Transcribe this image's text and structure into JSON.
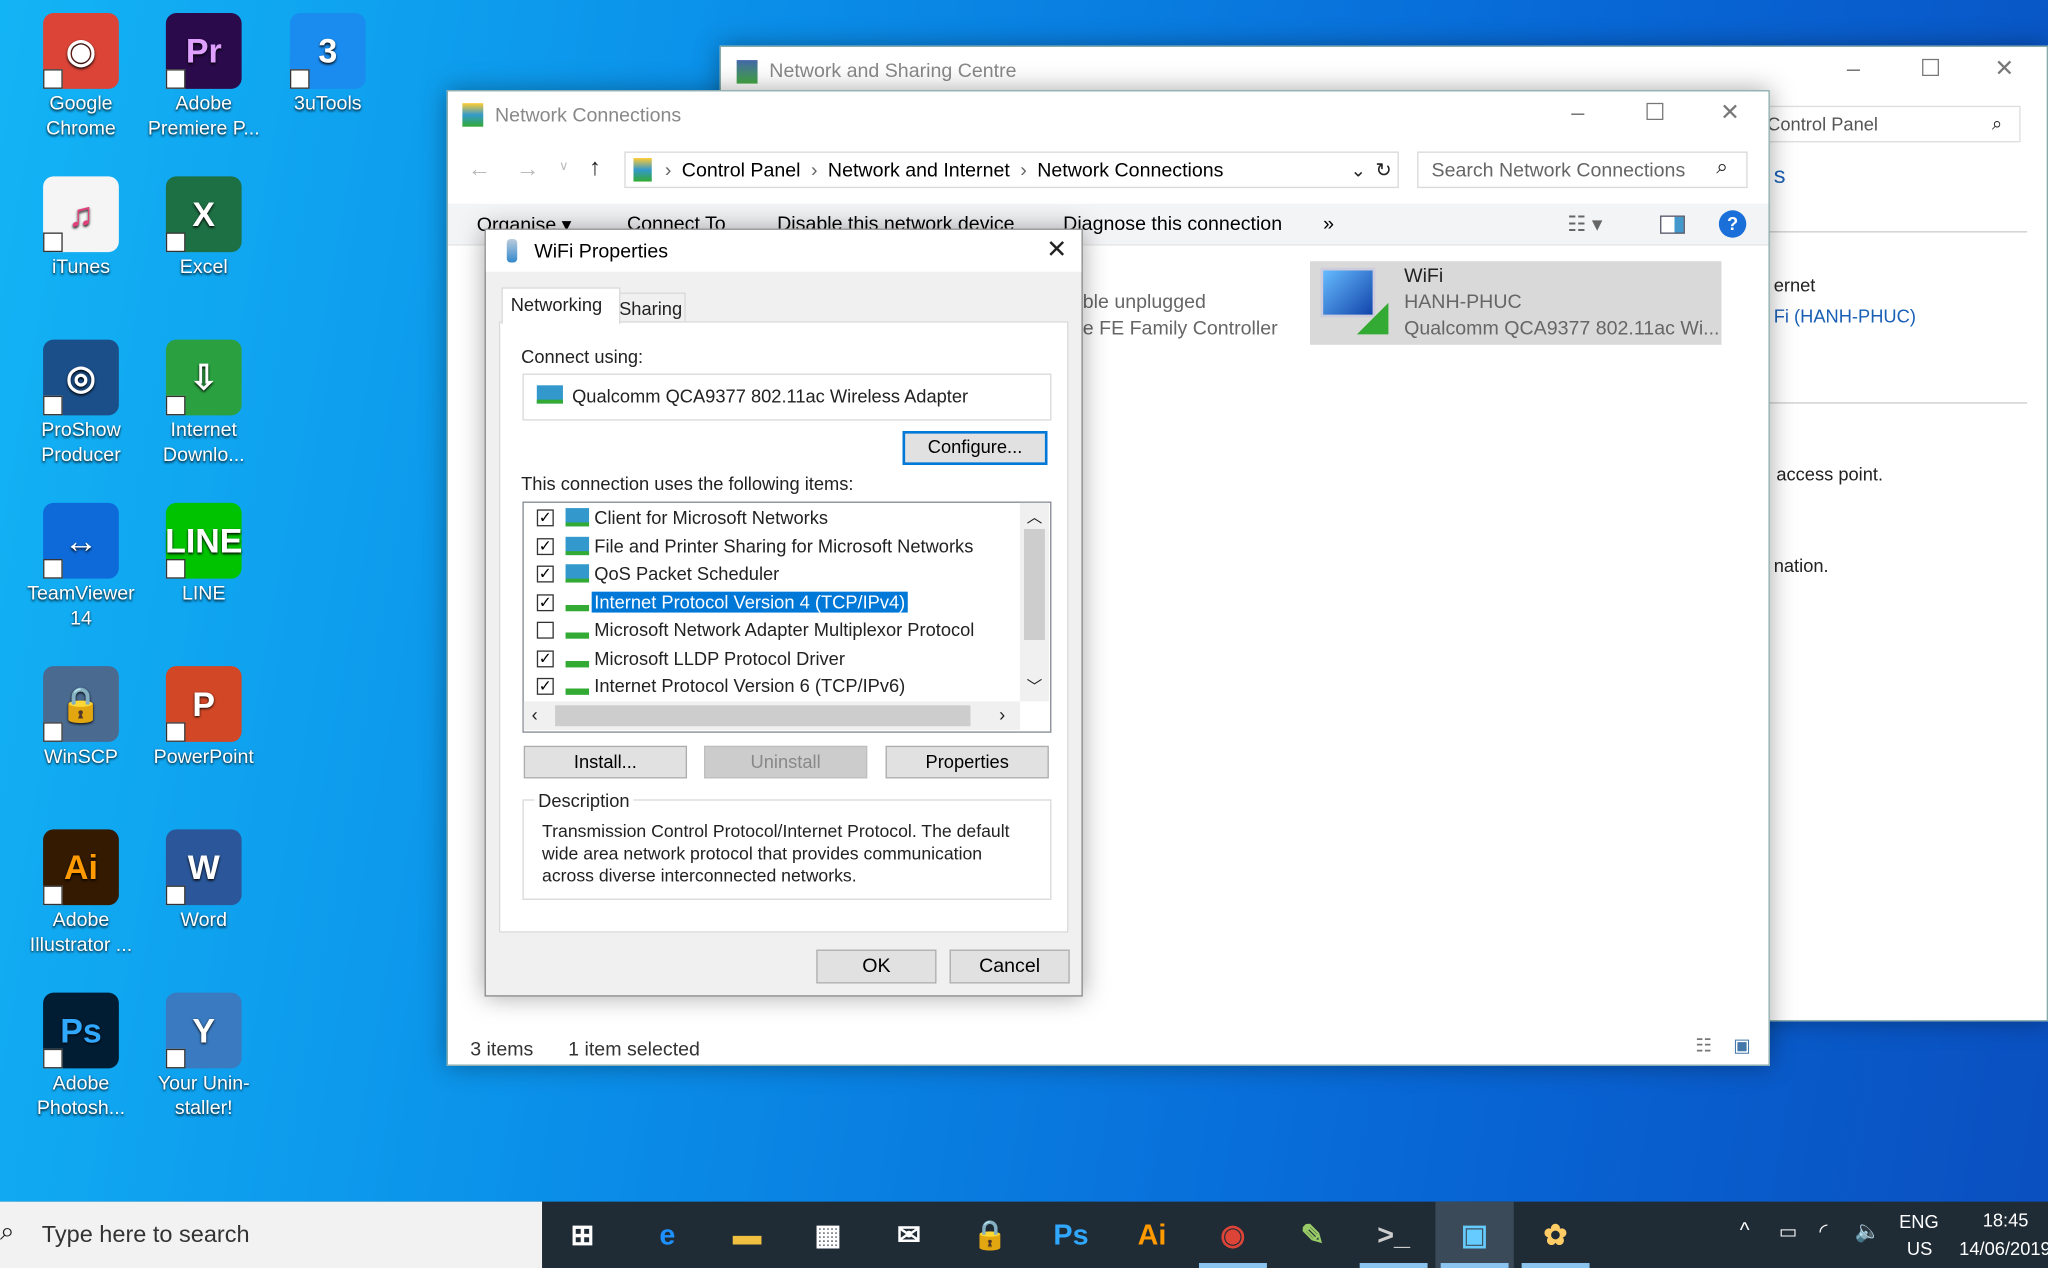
{
  "desktop": {
    "icons": [
      {
        "label": "Google Chrome",
        "color": "#db4437",
        "glyph": "◉"
      },
      {
        "label": "Adobe Premiere P...",
        "color": "#2a0a4a",
        "glyph": "Pr",
        "fg": "#e0a0ff"
      },
      {
        "label": "3uTools",
        "color": "#1a8cf0",
        "glyph": "3"
      },
      {
        "label": "iTunes",
        "color": "#f5f5f5",
        "glyph": "♫",
        "fg": "#e0407a"
      },
      {
        "label": "Excel",
        "color": "#1d7044",
        "glyph": "X"
      },
      {
        "label": "ProShow Producer",
        "color": "#1a4f8a",
        "glyph": "◎"
      },
      {
        "label": "Internet Downlo...",
        "color": "#2aa040",
        "glyph": "⇩"
      },
      {
        "label": "TeamViewer 14",
        "color": "#0e6ad8",
        "glyph": "↔"
      },
      {
        "label": "LINE",
        "color": "#00c300",
        "glyph": "LINE"
      },
      {
        "label": "WinSCP",
        "color": "#4a6a90",
        "glyph": "🔒"
      },
      {
        "label": "PowerPoint",
        "color": "#d24726",
        "glyph": "P"
      },
      {
        "label": "Adobe Illustrator ...",
        "color": "#331a00",
        "glyph": "Ai",
        "fg": "#ff9a00"
      },
      {
        "label": "Word",
        "color": "#2b579a",
        "glyph": "W"
      },
      {
        "label": "Adobe Photosh...",
        "color": "#001d34",
        "glyph": "Ps",
        "fg": "#31a8ff"
      },
      {
        "label": "Your Unin-staller!",
        "color": "#3a7ac0",
        "glyph": "Y"
      }
    ]
  },
  "sharing_window": {
    "title": "Network and Sharing Centre",
    "search_value": "Control Panel",
    "frag_s": "s",
    "frag_internet": "ernet",
    "frag_wifi_link": "Fi (HANH-PHUC)",
    "frag_access": "access point.",
    "frag_info": "nation."
  },
  "connections_window": {
    "title": "Network Connections",
    "breadcrumb": [
      "Control Panel",
      "Network and Internet",
      "Network Connections"
    ],
    "search_placeholder": "Search Network Connections",
    "commands": [
      "Organise ▾",
      "Connect To",
      "Disable this network device",
      "Diagnose this connection",
      "»"
    ],
    "eth_frag1": "ble unplugged",
    "eth_frag2": "e FE Family Controller",
    "wifi_tile": {
      "name": "WiFi",
      "network": "HANH-PHUC",
      "adapter": "Qualcomm QCA9377 802.11ac Wi..."
    },
    "status": {
      "items": "3 items",
      "selected": "1 item selected"
    }
  },
  "dialog": {
    "title": "WiFi Properties",
    "tabs": [
      "Networking",
      "Sharing"
    ],
    "connect_using_label": "Connect using:",
    "adapter": "Qualcomm QCA9377 802.11ac Wireless Adapter",
    "configure": "Configure...",
    "items_label": "This connection uses the following items:",
    "items": [
      {
        "label": "Client for Microsoft Networks",
        "checked": true,
        "icon": "client"
      },
      {
        "label": "File and Printer Sharing for Microsoft Networks",
        "checked": true,
        "icon": "service"
      },
      {
        "label": "QoS Packet Scheduler",
        "checked": true,
        "icon": "service"
      },
      {
        "label": "Internet Protocol Version 4 (TCP/IPv4)",
        "checked": true,
        "icon": "protocol",
        "selected": true
      },
      {
        "label": "Microsoft Network Adapter Multiplexor Protocol",
        "checked": false,
        "icon": "protocol"
      },
      {
        "label": "Microsoft LLDP Protocol Driver",
        "checked": true,
        "icon": "protocol"
      },
      {
        "label": "Internet Protocol Version 6 (TCP/IPv6)",
        "checked": true,
        "icon": "protocol"
      }
    ],
    "install": "Install...",
    "uninstall": "Uninstall",
    "properties": "Properties",
    "description_label": "Description",
    "description": "Transmission Control Protocol/Internet Protocol. The default wide area network protocol that provides communication across diverse interconnected networks.",
    "ok": "OK",
    "cancel": "Cancel"
  },
  "taskbar": {
    "search_placeholder": "Type here to search",
    "apps": [
      {
        "name": "task-view",
        "glyph": "⊞",
        "color": "#fff"
      },
      {
        "name": "edge",
        "glyph": "e",
        "color": "#1e90ff"
      },
      {
        "name": "file-explorer",
        "glyph": "▬",
        "color": "#f0c040"
      },
      {
        "name": "store",
        "glyph": "▦",
        "color": "#fff"
      },
      {
        "name": "mail",
        "glyph": "✉",
        "color": "#fff"
      },
      {
        "name": "winscp",
        "glyph": "🔒",
        "color": "#aaa"
      },
      {
        "name": "photoshop",
        "glyph": "Ps",
        "color": "#31a8ff"
      },
      {
        "name": "illustrator",
        "glyph": "Ai",
        "color": "#ff9a00"
      },
      {
        "name": "chrome",
        "glyph": "◉",
        "color": "#db4437",
        "active": true
      },
      {
        "name": "notepad",
        "glyph": "✎",
        "color": "#9c6"
      },
      {
        "name": "cmd",
        "glyph": ">_",
        "color": "#ccc",
        "active": true
      },
      {
        "name": "control-panel",
        "glyph": "▣",
        "color": "#6cf",
        "active": true,
        "focused": true
      },
      {
        "name": "paint",
        "glyph": "✿",
        "color": "#fc6",
        "active": true
      }
    ],
    "lang": "ENG",
    "region": "US",
    "time": "18:45",
    "date": "14/06/2019"
  }
}
